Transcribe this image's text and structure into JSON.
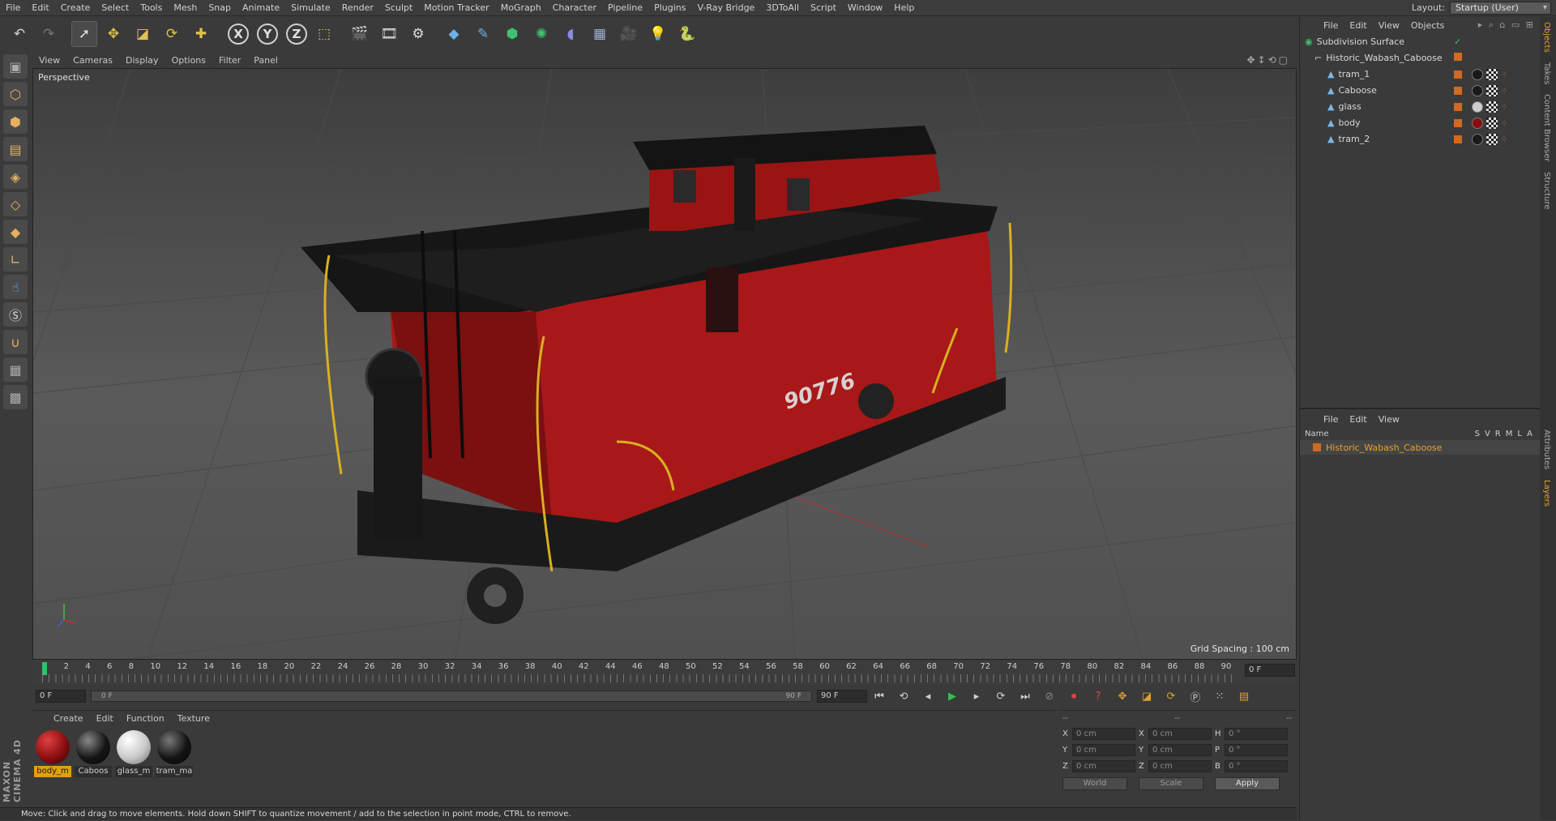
{
  "menubar": {
    "items": [
      "File",
      "Edit",
      "Create",
      "Select",
      "Tools",
      "Mesh",
      "Snap",
      "Animate",
      "Simulate",
      "Render",
      "Sculpt",
      "Motion Tracker",
      "MoGraph",
      "Character",
      "Pipeline",
      "Plugins",
      "V-Ray Bridge",
      "3DToAll",
      "Script",
      "Window",
      "Help"
    ],
    "layout_label": "Layout:",
    "layout_value": "Startup (User)"
  },
  "toolbar": {
    "icons": [
      "undo-icon",
      "redo-icon",
      "live-select-icon",
      "move-icon",
      "scale-icon",
      "rotate-icon",
      "add-icon",
      "x-axis-icon",
      "y-axis-icon",
      "z-axis-icon",
      "coordinate-system-icon",
      "render-view-icon",
      "render-picture-viewer-icon",
      "render-settings-icon",
      "cube-icon",
      "pen-icon",
      "subdivision-icon",
      "array-icon",
      "deformer-icon",
      "floor-icon",
      "camera-icon",
      "light-icon",
      "python-icon"
    ],
    "xyz": [
      "X",
      "Y",
      "Z"
    ]
  },
  "viewport": {
    "menu": [
      "View",
      "Cameras",
      "Display",
      "Options",
      "Filter",
      "Panel"
    ],
    "label": "Perspective",
    "grid_spacing": "Grid Spacing : 100 cm",
    "car_number": "90776"
  },
  "timeline": {
    "ticks": [
      "0",
      "2",
      "4",
      "6",
      "8",
      "10",
      "12",
      "14",
      "16",
      "18",
      "20",
      "22",
      "24",
      "26",
      "28",
      "30",
      "32",
      "34",
      "36",
      "38",
      "40",
      "42",
      "44",
      "46",
      "48",
      "50",
      "52",
      "54",
      "56",
      "58",
      "60",
      "62",
      "64",
      "66",
      "68",
      "70",
      "72",
      "74",
      "76",
      "78",
      "80",
      "82",
      "84",
      "86",
      "88",
      "90"
    ],
    "current_frame": "0 F",
    "start_field": "0 F",
    "range_start": "0 F",
    "range_end": "90 F",
    "end_field": "90 F"
  },
  "materials": {
    "menu": [
      "Create",
      "Edit",
      "Function",
      "Texture"
    ],
    "items": [
      {
        "name": "body_m",
        "color": "#8a0e10",
        "selected": true
      },
      {
        "name": "Caboos",
        "color": "#151515",
        "selected": false
      },
      {
        "name": "glass_m",
        "color": "#c8c8c8",
        "selected": false
      },
      {
        "name": "tram_ma",
        "color": "#141414",
        "selected": false
      }
    ]
  },
  "coords": {
    "headers": [
      "--",
      "--",
      "--"
    ],
    "rows": [
      {
        "a": "X",
        "av": "0 cm",
        "b": "X",
        "bv": "0 cm",
        "c": "H",
        "cv": "0 °"
      },
      {
        "a": "Y",
        "av": "0 cm",
        "b": "Y",
        "bv": "0 cm",
        "c": "P",
        "cv": "0 °"
      },
      {
        "a": "Z",
        "av": "0 cm",
        "b": "Z",
        "bv": "0 cm",
        "c": "B",
        "cv": "0 °"
      }
    ],
    "world": "World",
    "scale": "Scale",
    "apply": "Apply"
  },
  "status": "Move: Click and drag to move elements. Hold down SHIFT to quantize movement / add to the selection in point mode, CTRL to remove.",
  "objects": {
    "menu": [
      "File",
      "Edit",
      "View",
      "Objects"
    ],
    "tree": [
      {
        "name": "Subdivision Surface",
        "level": 0,
        "icon": "subdivision"
      },
      {
        "name": "Historic_Wabash_Caboose",
        "level": 1,
        "icon": "null"
      },
      {
        "name": "tram_1",
        "level": 2,
        "icon": "polygon",
        "tag": "#1a1a1a"
      },
      {
        "name": "Caboose",
        "level": 2,
        "icon": "polygon",
        "tag": "#1a1a1a"
      },
      {
        "name": "glass",
        "level": 2,
        "icon": "polygon",
        "tag": "#cfcfcf"
      },
      {
        "name": "body",
        "level": 2,
        "icon": "polygon",
        "tag": "#8a0e10"
      },
      {
        "name": "tram_2",
        "level": 2,
        "icon": "polygon",
        "tag": "#1a1a1a"
      }
    ]
  },
  "layers": {
    "menu": [
      "File",
      "Edit",
      "View"
    ],
    "name_header": "Name",
    "cols": "SVRMLA",
    "rows": [
      "Historic_Wabash_Caboose"
    ]
  },
  "sidetabs": [
    "Objects",
    "Takes",
    "Content Browser",
    "Structure",
    "Attributes",
    "Layers"
  ],
  "maxon": "MAXON CINEMA 4D"
}
